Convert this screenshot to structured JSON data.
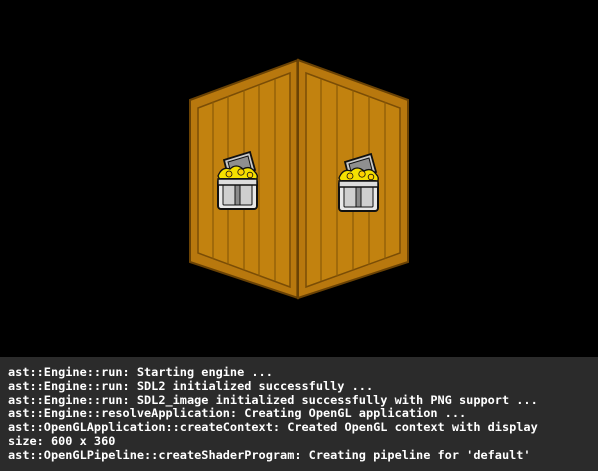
{
  "viewport": {
    "object": "wooden-crate",
    "crate_face_icon": "treasure-chest-icon",
    "colors": {
      "background": "#000000",
      "wood": "#b8780e",
      "wood_dark": "#8a5a08",
      "gold": "#f5e000"
    }
  },
  "console": {
    "background": "#2b2b2b",
    "lines": [
      "ast::Engine::run: Starting engine ...",
      "ast::Engine::run: SDL2 initialized successfully ...",
      "ast::Engine::run: SDL2_image initialized successfully with PNG support ...",
      "ast::Engine::resolveApplication: Creating OpenGL application ...",
      "ast::OpenGLApplication::createContext: Created OpenGL context with display",
      "size: 600 x 360",
      "ast::OpenGLPipeline::createShaderProgram: Creating pipeline for 'default'"
    ]
  }
}
